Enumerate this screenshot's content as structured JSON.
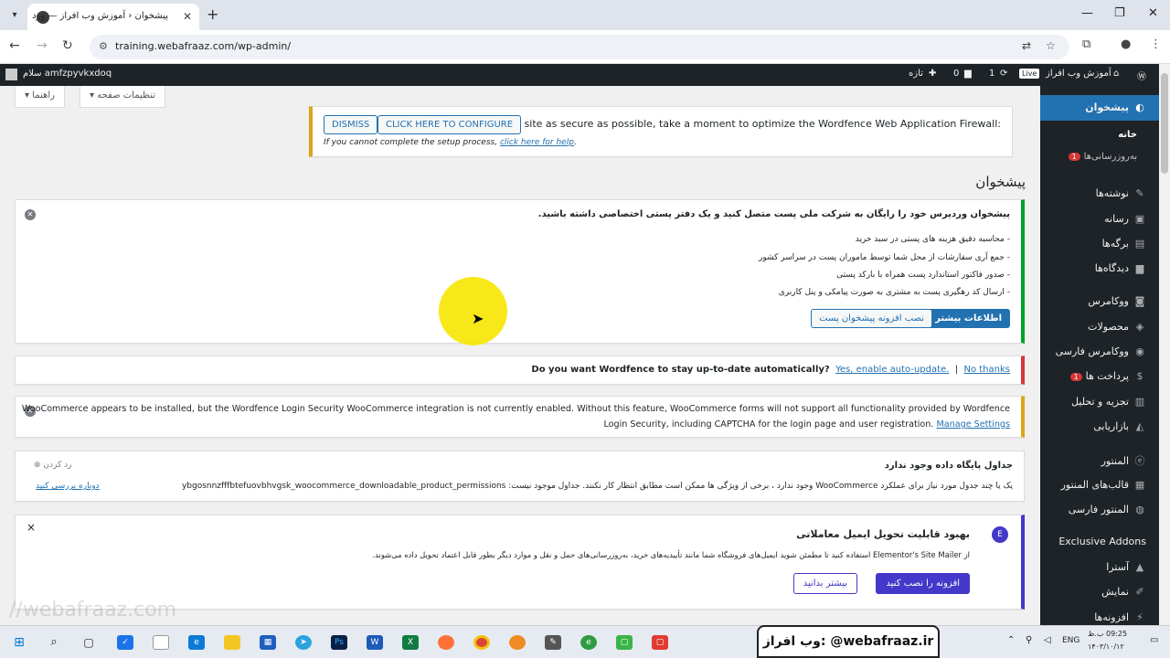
{
  "browser": {
    "tab_title": "پیشخوان ‹ آموزش وب افراز — ورد",
    "url": "training.webafraaz.com/wp-admin/"
  },
  "adminbar": {
    "greeting": "سلام amfzpyvkxdoq",
    "site_name": "آموزش وب افراز",
    "live": "Live",
    "updates": "1",
    "comments": "0",
    "new": "تازه"
  },
  "screen_options": {
    "options": "تنظیمات صفحه ▾",
    "help": "راهنما ▾"
  },
  "wordfence_waf": {
    "message": "To make your site as secure as possible, take a moment to optimize the Wordfence Web Application Firewall:",
    "configure": "CLICK HERE TO CONFIGURE",
    "dismiss": "DISMISS",
    "help_prefix": "If you cannot complete the setup process,",
    "help_link": "click here for help",
    "help_suffix": "."
  },
  "page_title": "پیشخوان",
  "post_notice": {
    "heading": "پیشخوان وردپرس خود را رایگان به شرکت ملی پست متصل کنید و یک دفتر پستی اختصاصی داشته باشید.",
    "items": [
      "- محاسبه دقیق هزینه های پستی در سبد خرید",
      "- جمع آری سفارشات از محل شما توسط ماموران پست در سراسر کشور",
      "- صدور فاکتور استاندارد پست همراه با بارکد پستی",
      "- ارسال کد رهگیری پست به مشتری به صورت پیامکی و پنل کاربری"
    ],
    "more_btn": "اطلاعات بیشتر",
    "install_btn": "نصب افزونه پیشخوان پست"
  },
  "autoupdate": {
    "question": "Do you want Wordfence to stay up-to-date automatically?",
    "yes": "Yes, enable auto-update.",
    "sep": "|",
    "no": "No thanks"
  },
  "woo_notice": {
    "line1": "WooCommerce appears to be installed, but the Wordfence Login Security WooCommerce integration is not currently enabled. Without this feature, WooCommerce forms will not support all functionality provided by Wordfence",
    "line2": "Login Security, including CAPTCHA for the login page and user registration.",
    "link": "Manage Settings"
  },
  "db_notice": {
    "heading": "جداول پایگاه داده وجود ندارد",
    "dismiss": "رد کردن",
    "text": "یک یا چند جدول مورد نیاز برای عملکرد WooCommerce وجود ندارد ، برخی از ویژگی ها ممکن است مطابق انتظار کار نکنند. جداول موجود نیست: ybgosnnzfffbtefuovbhvgsk_woocommerce_downloadable_product_permissions",
    "link": "دوباره بررسی کنید"
  },
  "elementor_notice": {
    "heading": "بهبود قابلیت تحویل ایمیل معاملاتی",
    "text": "از Elementor's Site Mailer استفاده کنید تا مطمئن شوید ایمیل‌های فروشگاه شما مانند تأییدیه‌های خرید، به‌روزرسانی‌های حمل و نقل و موارد دیگر بطور قابل اعتماد تحویل داده می‌شوند.",
    "install": "افزونه را نصب کنید",
    "learn": "بیشتر بدانید",
    "close": "×"
  },
  "sidebar": {
    "dashboard": "پیشخوان",
    "home": "خانه",
    "updates": "به‌روزرسانی‌ها",
    "updates_count": "1",
    "items": [
      "نوشته‌ها",
      "رسانه",
      "برگه‌ها",
      "دیدگاه‌ها",
      "ووکامرس",
      "محصولات",
      "ووکامرس فارسی",
      "پرداخت ها",
      "تجزیه و تحلیل",
      "بازاریابی",
      "المنتور",
      "قالب‌های المنتور",
      "المنتور فارسی",
      "Exclusive Addons",
      "آسترا",
      "نمایش",
      "افزونه‌ها"
    ],
    "payments_count": "1"
  },
  "taskbar": {
    "promo": "وب افراز: @webafraaz.ir",
    "lang": "ENG",
    "time": "09:25 ب.ظ",
    "date": "۱۴۰۳/۱۰/۱۲"
  },
  "watermark": "//webafraaz.com",
  "colors": {
    "admin_bar": "#1d2327",
    "accent": "#2271b1",
    "warning": "#dba617",
    "error": "#d63638",
    "success": "#00a32a"
  }
}
